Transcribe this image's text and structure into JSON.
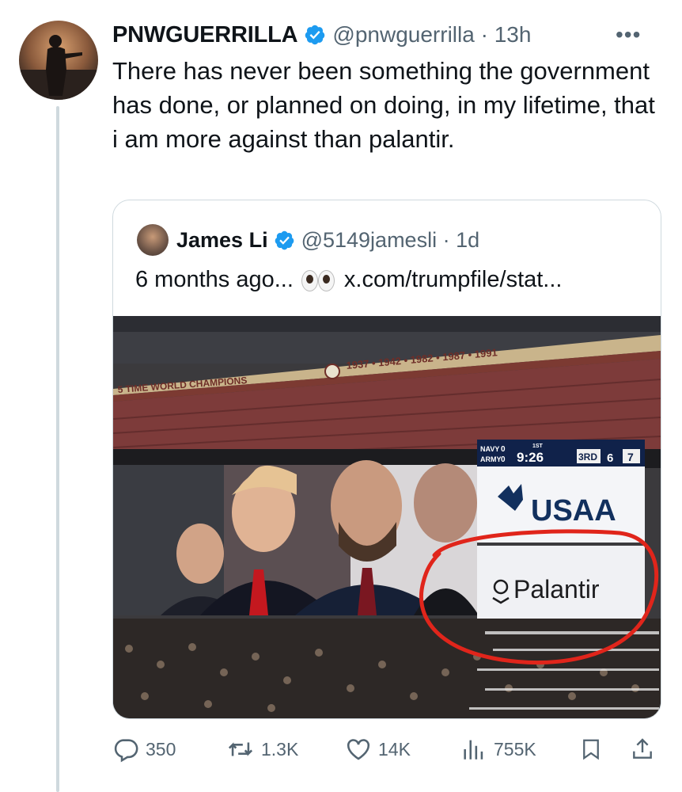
{
  "tweet": {
    "author_name": "PNWGUERRILLA",
    "handle_time": "@pnwguerrilla · 13h",
    "more": "•••",
    "text": "There has never been something the government has done, or planned on doing, in my lifetime, that i am more against than palantir."
  },
  "quote": {
    "author_name": "James Li",
    "handle_time": "@5149jamesli · 1d",
    "text_before": "6 months ago...",
    "text_link": "x.com/trumpfile/stat...",
    "image": {
      "banner_left": "5 TIME WORLD CHAMPIONS",
      "banner_years": "1937 • 1942 • 1982 • 1987 • 1991",
      "score_teams": [
        "NAVY",
        "ARMY"
      ],
      "score_values": [
        "0",
        "0"
      ],
      "quarter": "1ST",
      "clock": "9:26",
      "down": "3RD",
      "togo": "6",
      "ball_on": "7",
      "sponsor_1": "USAA",
      "sponsor_2": "Palantir"
    }
  },
  "actions": {
    "replies": "350",
    "reposts": "1.3K",
    "likes": "14K",
    "views": "755K"
  },
  "colors": {
    "verified": "#1d9bf0",
    "secondary_text": "#536471",
    "border": "#cfd9de",
    "annotation_circle": "#e0251b"
  }
}
